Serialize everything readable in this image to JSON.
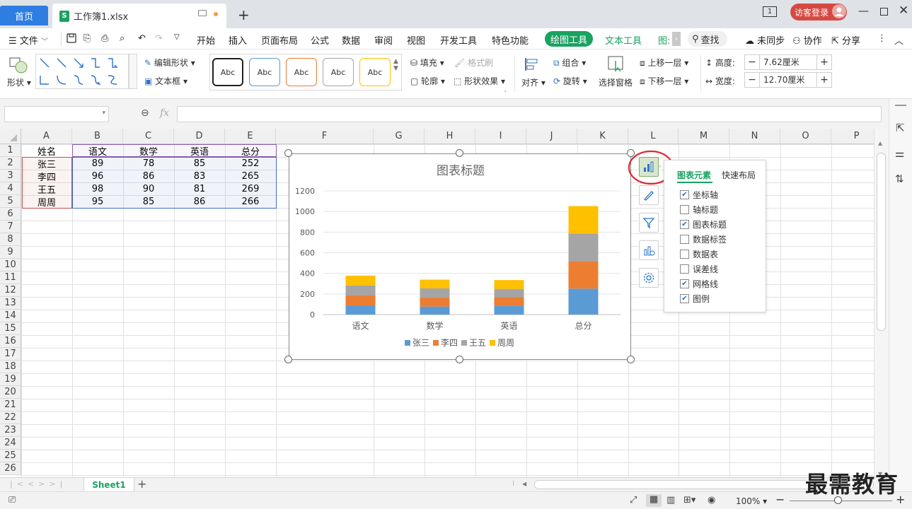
{
  "titlebar": {
    "home_tab": "首页",
    "file_name": "工作簿1.xlsx",
    "file_icon": "S",
    "window_count": "1",
    "visitor_login": "访客登录"
  },
  "menu": {
    "file": "文件",
    "items": [
      "开始",
      "插入",
      "页面布局",
      "公式",
      "数据",
      "审阅",
      "视图",
      "开发工具",
      "特色功能"
    ],
    "drawing_tools": "绘图工具",
    "text_tools": "文本工具",
    "chart_tools_truncated": "图:",
    "search": "查找",
    "unsynced": "未同步",
    "collaborate": "协作",
    "share": "分享"
  },
  "ribbon": {
    "shape": "形状",
    "edit_shape": "编辑形状",
    "text_box": "文本框",
    "abc": [
      "Abc",
      "Abc",
      "Abc",
      "Abc",
      "Abc"
    ],
    "abc_colors": [
      "#222222",
      "#5b9bd5",
      "#ed7d31",
      "#a5a5a5",
      "#ffc000"
    ],
    "fill": "填充",
    "format_painter": "格式刷",
    "outline": "轮廓",
    "shape_effects": "形状效果",
    "align": "对齐",
    "group": "组合",
    "rotate": "旋转",
    "selection_pane": "选择窗格",
    "bring_forward": "上移一层",
    "send_backward": "下移一层",
    "height_label": "高度:",
    "height_value": "7.62厘米",
    "width_label": "宽度:",
    "width_value": "12.70厘米"
  },
  "formula_bar": {
    "fx": "fx"
  },
  "grid": {
    "columns": [
      "A",
      "B",
      "C",
      "D",
      "E",
      "F",
      "G",
      "H",
      "I",
      "J",
      "K",
      "L",
      "M",
      "N",
      "O",
      "P"
    ],
    "rows": [
      "1",
      "2",
      "3",
      "4",
      "5",
      "6",
      "7",
      "8",
      "9",
      "10",
      "11",
      "12",
      "13",
      "14",
      "15",
      "16",
      "17",
      "18",
      "19",
      "20",
      "21",
      "22",
      "23",
      "24",
      "25",
      "26"
    ],
    "header": [
      "姓名",
      "语文",
      "数学",
      "英语",
      "总分"
    ],
    "data": [
      [
        "张三",
        "89",
        "78",
        "85",
        "252"
      ],
      [
        "李四",
        "96",
        "86",
        "83",
        "265"
      ],
      [
        "王五",
        "98",
        "90",
        "81",
        "269"
      ],
      [
        "周周",
        "95",
        "85",
        "86",
        "266"
      ]
    ]
  },
  "chart_data": {
    "type": "bar",
    "stacked": true,
    "title": "图表标题",
    "categories": [
      "语文",
      "数学",
      "英语",
      "总分"
    ],
    "series": [
      {
        "name": "张三",
        "values": [
          89,
          78,
          85,
          252
        ],
        "color": "#5b9bd5"
      },
      {
        "name": "李四",
        "values": [
          96,
          86,
          83,
          265
        ],
        "color": "#ed7d31"
      },
      {
        "name": "王五",
        "values": [
          98,
          90,
          81,
          269
        ],
        "color": "#a5a5a5"
      },
      {
        "name": "周周",
        "values": [
          95,
          85,
          86,
          266
        ],
        "color": "#ffc000"
      }
    ],
    "yticks": [
      0,
      200,
      400,
      600,
      800,
      1000,
      1200
    ],
    "ylim": [
      0,
      1200
    ],
    "grid": true,
    "legend": "bottom"
  },
  "chart_elements_panel": {
    "tab_elements": "图表元素",
    "tab_quick_layout": "快速布局",
    "options": [
      {
        "label": "坐标轴",
        "checked": true
      },
      {
        "label": "轴标题",
        "checked": false
      },
      {
        "label": "图表标题",
        "checked": true
      },
      {
        "label": "数据标签",
        "checked": false
      },
      {
        "label": "数据表",
        "checked": false
      },
      {
        "label": "误差线",
        "checked": false
      },
      {
        "label": "网格线",
        "checked": true
      },
      {
        "label": "图例",
        "checked": true
      }
    ]
  },
  "sheets": {
    "active": "Sheet1"
  },
  "status": {
    "zoom": "100%"
  },
  "watermark": "最需教育",
  "colors": {
    "accent_green": "#1aa261",
    "home_blue": "#2e7de1",
    "visitor_red": "#d64943",
    "highlight_circle": "#e0282e"
  }
}
